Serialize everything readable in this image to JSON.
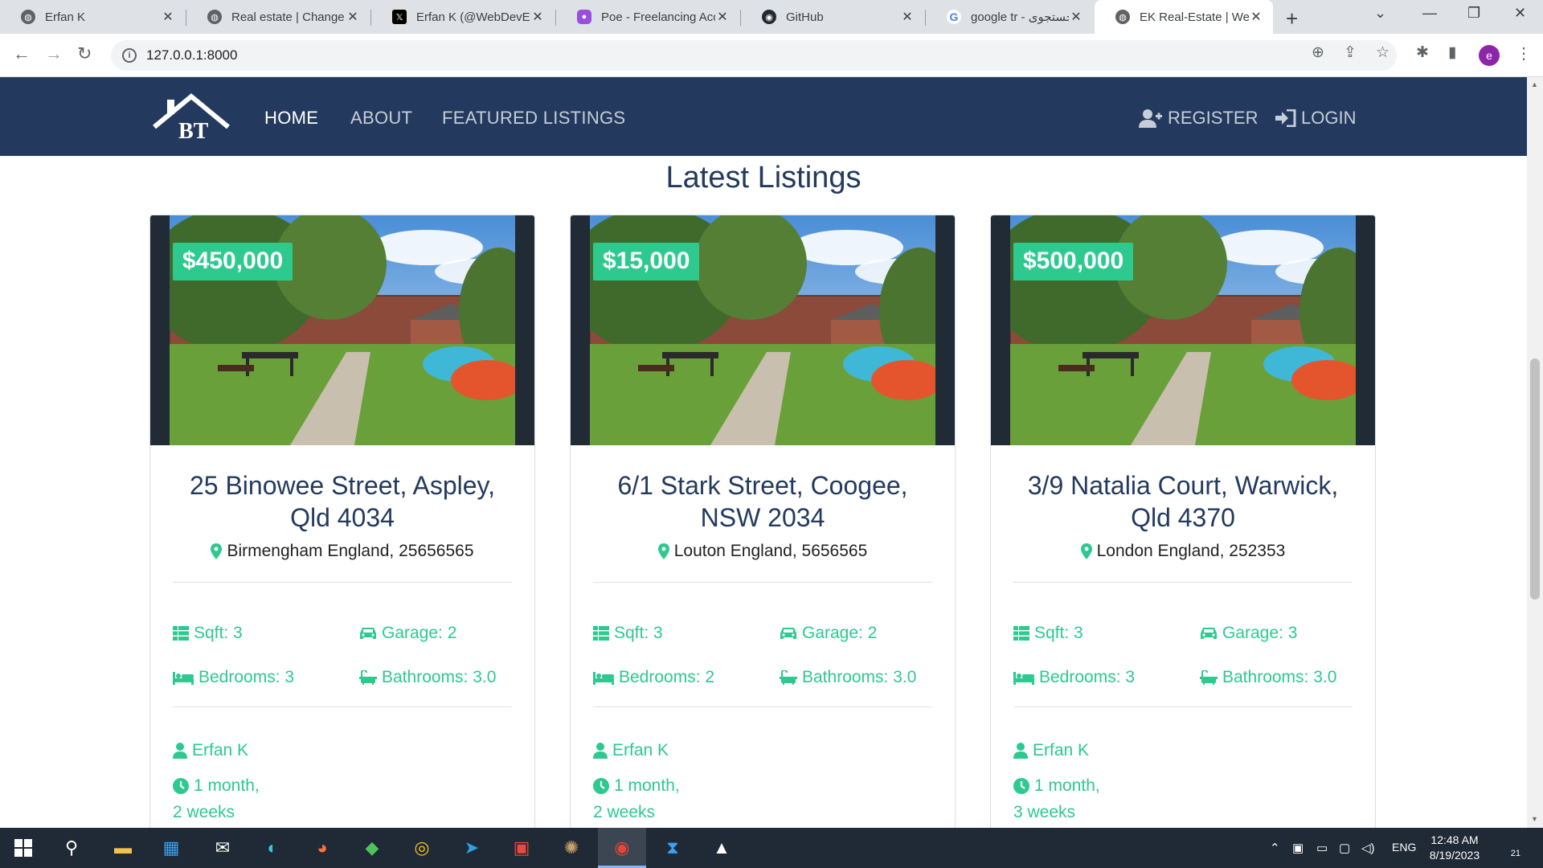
{
  "browser": {
    "tabs": [
      {
        "title": "Erfan K",
        "icon": "globe-icon"
      },
      {
        "title": "Real estate | Change p",
        "icon": "globe-icon"
      },
      {
        "title": "Erfan K (@WebDevErf",
        "icon": "x-logo-icon"
      },
      {
        "title": "Poe - Freelancing Acc",
        "icon": "poe-icon"
      },
      {
        "title": "GitHub",
        "icon": "github-icon"
      },
      {
        "title": "google tr - جستجوی G",
        "icon": "google-icon"
      },
      {
        "title": "EK Real-Estate | Welco",
        "icon": "globe-icon"
      }
    ],
    "url": "127.0.0.1:8000"
  },
  "site": {
    "logo_text": "BT",
    "nav": {
      "home": "HOME",
      "about": "ABOUT",
      "featured": "FEATURED LISTINGS",
      "register": "REGISTER",
      "login": "LOGIN"
    },
    "section_title": "Latest Listings",
    "accent_color": "#2dc98f",
    "navbar_color": "#233a5e"
  },
  "listings": [
    {
      "price": "$450,000",
      "title": "25 Binowee Street, Aspley, Qld 4034",
      "location": "Birmengham England, 25656565",
      "sqft": "Sqft: 3",
      "garage": "Garage: 2",
      "bedrooms": "Bedrooms: 3",
      "bathrooms": "Bathrooms: 3.0",
      "realtor": "Erfan K",
      "age_line1": "1 month,",
      "age_line2": "2 weeks"
    },
    {
      "price": "$15,000",
      "title": "6/1 Stark Street, Coogee, NSW 2034",
      "location": "Louton England, 5656565",
      "sqft": "Sqft: 3",
      "garage": "Garage: 2",
      "bedrooms": "Bedrooms: 2",
      "bathrooms": "Bathrooms: 3.0",
      "realtor": "Erfan K",
      "age_line1": "1 month,",
      "age_line2": "2 weeks"
    },
    {
      "price": "$500,000",
      "title": "3/9 Natalia Court, Warwick, Qld 4370",
      "location": "London England, 252353",
      "sqft": "Sqft: 3",
      "garage": "Garage: 3",
      "bedrooms": "Bedrooms: 3",
      "bathrooms": "Bathrooms: 3.0",
      "realtor": "Erfan K",
      "age_line1": "1 month,",
      "age_line2": "3 weeks"
    }
  ],
  "taskbar": {
    "language": "ENG",
    "time": "12:48 AM",
    "date": "8/19/2023",
    "notifications": "21"
  }
}
